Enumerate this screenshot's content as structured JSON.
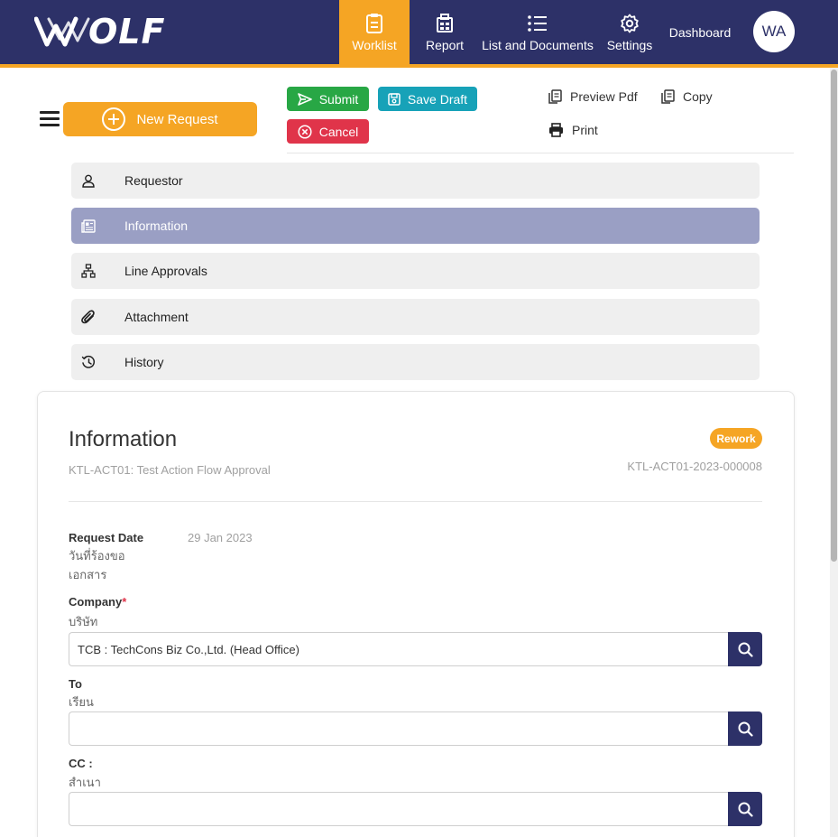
{
  "header": {
    "brand": "OLF",
    "nav": [
      {
        "label": "Worklist",
        "icon": "clipboard-icon",
        "active": true
      },
      {
        "label": "Report",
        "icon": "report-icon"
      },
      {
        "label": "List and Documents",
        "icon": "list-icon"
      },
      {
        "label": "Settings",
        "icon": "gear-icon"
      }
    ],
    "dashboard_label": "Dashboard",
    "avatar_initials": "WA",
    "accent_color": "#f5a524",
    "bar_color": "#2d3168"
  },
  "toolbar": {
    "new_request_label": "New Request",
    "submit_label": "Submit",
    "save_draft_label": "Save Draft",
    "cancel_label": "Cancel",
    "preview_pdf_label": "Preview Pdf",
    "copy_label": "Copy",
    "print_label": "Print"
  },
  "sections": [
    {
      "label": "Requestor",
      "icon": "user-icon"
    },
    {
      "label": "Information",
      "icon": "document-icon",
      "active": true
    },
    {
      "label": "Line Approvals",
      "icon": "sitemap-icon"
    },
    {
      "label": "Attachment",
      "icon": "paperclip-icon"
    },
    {
      "label": "History",
      "icon": "history-icon"
    }
  ],
  "card": {
    "title": "Information",
    "subtitle": "KTL-ACT01: Test Action Flow Approval",
    "status_badge": "Rework",
    "document_no": "KTL-ACT01-2023-000008"
  },
  "form": {
    "request_date": {
      "label": "Request Date",
      "sub_line1": "วันที่ร้องขอ",
      "sub_line2": "เอกสาร",
      "value": "29 Jan 2023"
    },
    "company": {
      "label": "Company",
      "required": "*",
      "sub": "บริษัท",
      "value": "TCB : TechCons Biz Co.,Ltd. (Head Office)"
    },
    "to": {
      "label": "To",
      "sub": "เรียน",
      "value": ""
    },
    "cc": {
      "label": "CC :",
      "sub": "สำเนา",
      "value": ""
    }
  }
}
